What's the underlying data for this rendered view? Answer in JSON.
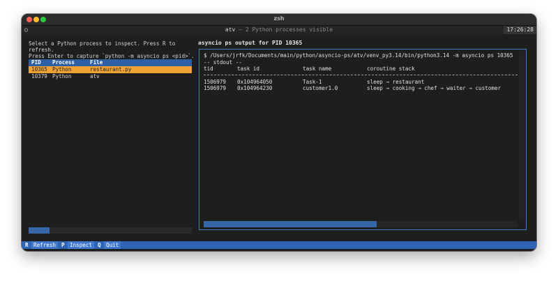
{
  "window": {
    "title": "zsh"
  },
  "header": {
    "icon": "circle-icon",
    "title": "atv",
    "subtitle": "– 2 Python processes visible",
    "clock": "17:26:28"
  },
  "left": {
    "instructions": [
      "Select a Python process to inspect. Press R to",
      "refresh.",
      "Press Enter to capture `python -m asyncio ps <pid>`."
    ],
    "columns": [
      "PID",
      "Process",
      "File"
    ],
    "rows": [
      {
        "pid": "10365",
        "process": "Python",
        "file": "restaurant.py"
      },
      {
        "pid": "10379",
        "process": "Python",
        "file": "atv"
      }
    ]
  },
  "output": {
    "title": "asyncio ps output for PID 10365",
    "command": "$ /Users/jrfk/Documents/main/python/asyncio-ps/atv/venv_py3.14/bin/python3.14 -m asyncio ps 10365",
    "stdout_label": "-- stdout --",
    "columns": [
      "tid",
      "task id",
      "task name",
      "coroutine stack"
    ],
    "rows": [
      {
        "tid": "1506979",
        "task_id": "0x104964050",
        "task_name": "Task-1",
        "stack": "sleep → restaurant"
      },
      {
        "tid": "1506979",
        "task_id": "0x104964230",
        "task_name": "customer1.0",
        "stack": "sleep → cooking → chef → waiter → customer"
      }
    ]
  },
  "footer": {
    "items": [
      {
        "key": "R",
        "label": "Refresh"
      },
      {
        "key": "P",
        "label": "Inspect"
      },
      {
        "key": "Q",
        "label": "Quit"
      }
    ]
  },
  "colors": {
    "selection": "#f0a234",
    "accent": "#2f63b4",
    "border": "#4a7cc4"
  }
}
